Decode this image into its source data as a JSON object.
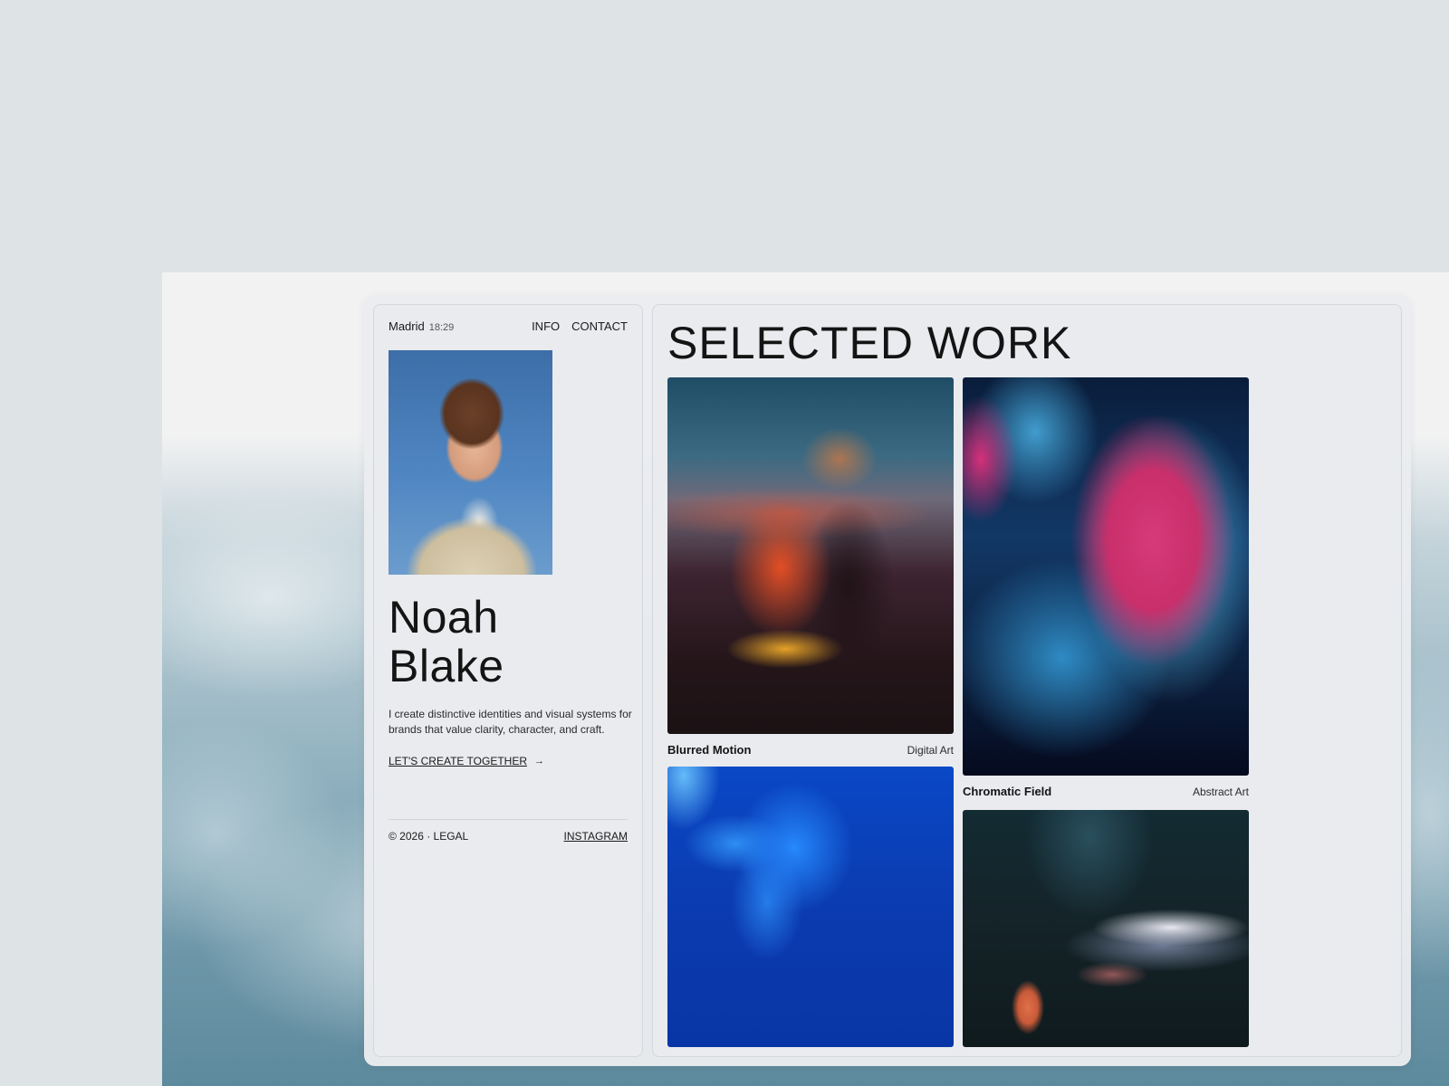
{
  "profile": {
    "city": "Madrid",
    "time": "18:29",
    "nav": [
      "INFO",
      "CONTACT"
    ],
    "first_name": "Noah",
    "last_name": "Blake",
    "bio": "I create distinctive identities and visual systems for brands that value clarity, character, and craft.",
    "cta_label": "LET'S CREATE TOGETHER",
    "cta_arrow": "→",
    "copyright": "© 2026 · LEGAL",
    "social": "INSTAGRAM"
  },
  "work": {
    "heading": "SELECTED WORK",
    "items": [
      {
        "title": "Blurred Motion",
        "category": "Digital Art"
      },
      {
        "title": "Chromatic Field",
        "category": "Abstract Art"
      },
      {
        "title": "",
        "category": ""
      },
      {
        "title": "",
        "category": ""
      }
    ]
  },
  "colors": {
    "background": "#dee3e6",
    "panel": "#e9ebee",
    "text": "#1a1a1a"
  }
}
